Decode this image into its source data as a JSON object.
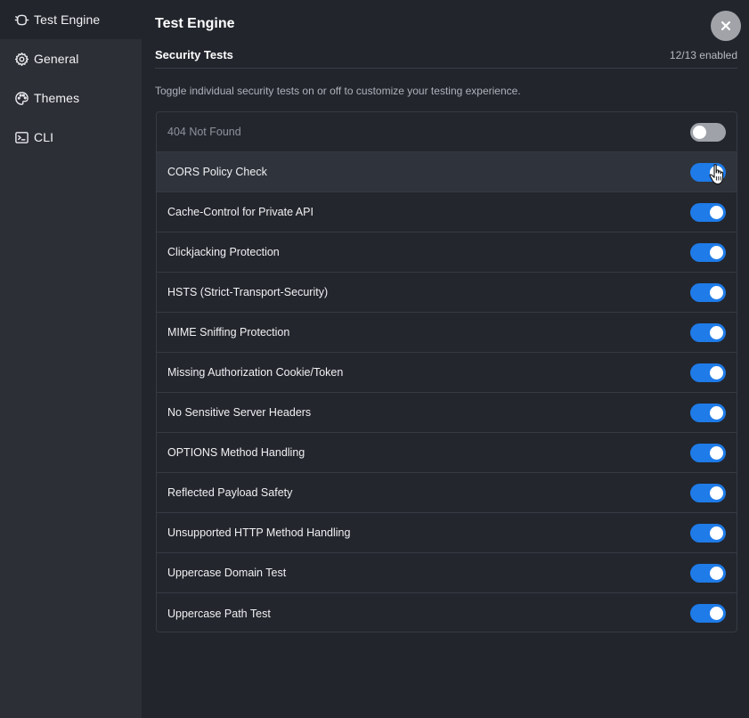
{
  "sidebar": {
    "items": [
      {
        "label": "Test Engine",
        "icon": "test-engine-icon",
        "active": true
      },
      {
        "label": "General",
        "icon": "gear-icon",
        "active": false
      },
      {
        "label": "Themes",
        "icon": "palette-icon",
        "active": false
      },
      {
        "label": "CLI",
        "icon": "terminal-icon",
        "active": false
      }
    ]
  },
  "header": {
    "title": "Test Engine",
    "close_icon": "close-icon"
  },
  "section": {
    "title": "Security Tests",
    "enabled_count": "12/13 enabled",
    "description": "Toggle individual security tests on or off to customize your testing experience."
  },
  "tests": [
    {
      "label": "404 Not Found",
      "enabled": false
    },
    {
      "label": "CORS Policy Check",
      "enabled": true
    },
    {
      "label": "Cache-Control for Private API",
      "enabled": true
    },
    {
      "label": "Clickjacking Protection",
      "enabled": true
    },
    {
      "label": "HSTS (Strict-Transport-Security)",
      "enabled": true
    },
    {
      "label": "MIME Sniffing Protection",
      "enabled": true
    },
    {
      "label": "Missing Authorization Cookie/Token",
      "enabled": true
    },
    {
      "label": "No Sensitive Server Headers",
      "enabled": true
    },
    {
      "label": "OPTIONS Method Handling",
      "enabled": true
    },
    {
      "label": "Reflected Payload Safety",
      "enabled": true
    },
    {
      "label": "Unsupported HTTP Method Handling",
      "enabled": true
    },
    {
      "label": "Uppercase Domain Test",
      "enabled": true
    },
    {
      "label": "Uppercase Path Test",
      "enabled": true
    }
  ],
  "colors": {
    "toggle_on": "#1e7be8",
    "toggle_off": "#9fa2a9",
    "background": "#22252c",
    "sidebar": "#2c2f36"
  }
}
